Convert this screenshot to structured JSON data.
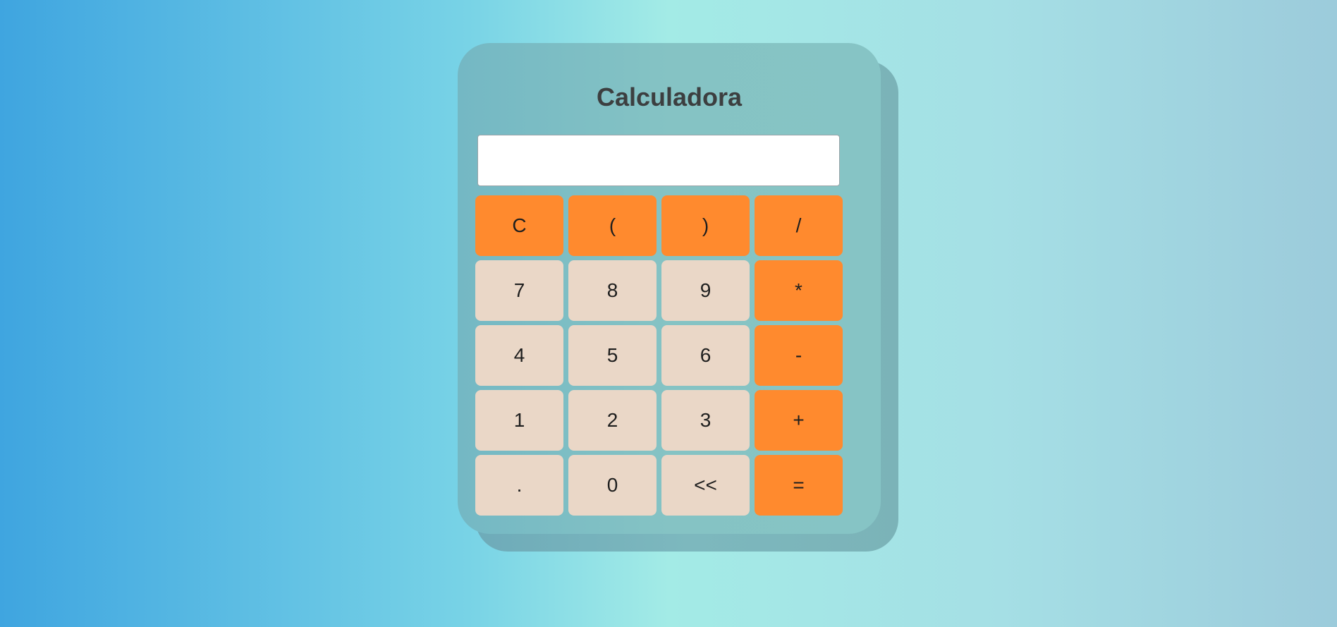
{
  "title": "Calculadora",
  "display": {
    "value": "",
    "placeholder": ""
  },
  "colors": {
    "operator_key": "#ff8a2e",
    "number_key": "#ead7c7",
    "calculator_body": "#85c3c4",
    "title_text": "#3c3f40"
  },
  "keys": {
    "clear": "C",
    "open_paren": "(",
    "close_paren": ")",
    "divide": "/",
    "seven": "7",
    "eight": "8",
    "nine": "9",
    "multiply": "*",
    "four": "4",
    "five": "5",
    "six": "6",
    "subtract": "-",
    "one": "1",
    "two": "2",
    "three": "3",
    "add": "+",
    "decimal": ".",
    "zero": "0",
    "backspace": "<<",
    "equals": "="
  }
}
